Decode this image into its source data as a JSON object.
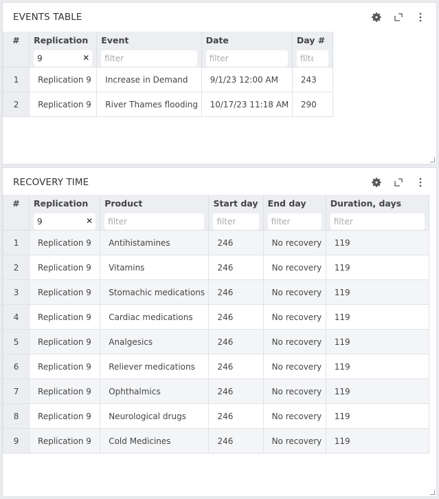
{
  "events": {
    "title": "EVENTS TABLE",
    "columns": [
      {
        "label": "#",
        "filter": null
      },
      {
        "label": "Replication",
        "filter": "9"
      },
      {
        "label": "Event",
        "filter": ""
      },
      {
        "label": "Date",
        "filter": ""
      },
      {
        "label": "Day #",
        "filter": ""
      }
    ],
    "filter_placeholder": "filter",
    "rows": [
      {
        "num": "1",
        "replication": "Replication 9",
        "event": "Increase in Demand",
        "date": "9/1/23 12:00 AM",
        "day": "243"
      },
      {
        "num": "2",
        "replication": "Replication 9",
        "event": "River Thames flooding",
        "date": "10/17/23 11:18 AM",
        "day": "290"
      }
    ]
  },
  "recovery": {
    "title": "RECOVERY TIME",
    "columns": [
      {
        "label": "#",
        "filter": null
      },
      {
        "label": "Replication",
        "filter": "9"
      },
      {
        "label": "Product",
        "filter": ""
      },
      {
        "label": "Start day",
        "filter": ""
      },
      {
        "label": "End day",
        "filter": ""
      },
      {
        "label": "Duration, days",
        "filter": ""
      }
    ],
    "filter_placeholder": "filter",
    "rows": [
      {
        "num": "1",
        "replication": "Replication 9",
        "product": "Antihistamines",
        "start": "246",
        "end": "No recovery",
        "duration": "119"
      },
      {
        "num": "2",
        "replication": "Replication 9",
        "product": "Vitamins",
        "start": "246",
        "end": "No recovery",
        "duration": "119"
      },
      {
        "num": "3",
        "replication": "Replication 9",
        "product": "Stomachic medications",
        "start": "246",
        "end": "No recovery",
        "duration": "119"
      },
      {
        "num": "4",
        "replication": "Replication 9",
        "product": "Cardiac medications",
        "start": "246",
        "end": "No recovery",
        "duration": "119"
      },
      {
        "num": "5",
        "replication": "Replication 9",
        "product": "Analgesics",
        "start": "246",
        "end": "No recovery",
        "duration": "119"
      },
      {
        "num": "6",
        "replication": "Replication 9",
        "product": "Reliever medications",
        "start": "246",
        "end": "No recovery",
        "duration": "119"
      },
      {
        "num": "7",
        "replication": "Replication 9",
        "product": "Ophthalmics",
        "start": "246",
        "end": "No recovery",
        "duration": "119"
      },
      {
        "num": "8",
        "replication": "Replication 9",
        "product": "Neurological drugs",
        "start": "246",
        "end": "No recovery",
        "duration": "119"
      },
      {
        "num": "9",
        "replication": "Replication 9",
        "product": "Cold Medicines",
        "start": "246",
        "end": "No recovery",
        "duration": "119"
      }
    ]
  },
  "icons": {
    "settings": "gear-icon",
    "expand": "expand-icon",
    "menu": "more-vertical-icon",
    "clear": "clear-filter-icon"
  }
}
